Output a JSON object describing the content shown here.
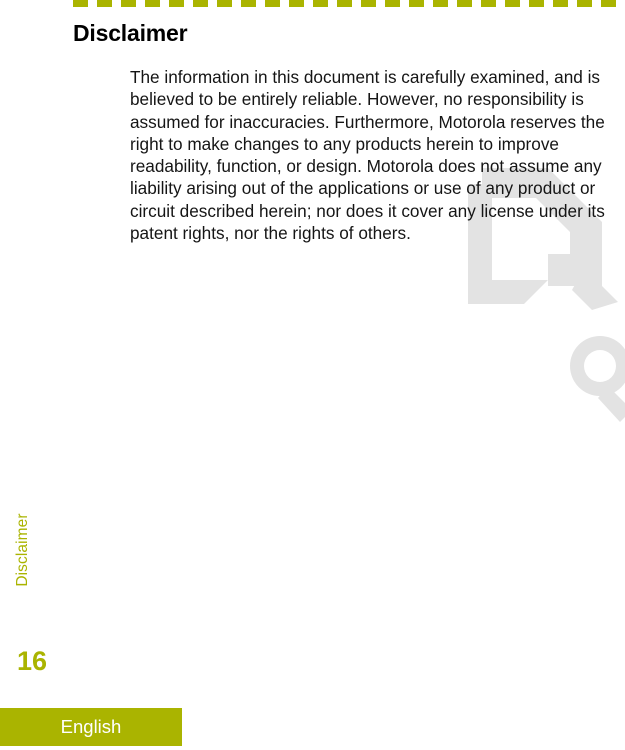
{
  "theme": {
    "accent_color": "#aab400",
    "text_color": "#151515",
    "heading_color": "#000000",
    "footer_text_color": "#ffffff",
    "watermark_color": "#e3e3e3",
    "page_background": "#ffffff"
  },
  "header": {
    "title": "Disclaimer",
    "rule_style": "dashed"
  },
  "content": {
    "paragraph": "The information in this document is carefully examined, and is believed to be entirely reliable. However, no responsibility is assumed for inaccuracies. Furthermore, Motorola reserves the right to make changes to any products herein to improve readability, function, or design. Motorola does not assume any liability arising out of the applications or use of any product or circuit described herein; nor does it cover any license under its patent rights, nor the rights of others.",
    "lines": [
      "The information in this document is carefully",
      "examined, and is believed to be entirely reliable.",
      "However, no responsibility is assumed for",
      "inaccuracies. Furthermore, Motorola reserves the",
      "right to make changes to any products herein to",
      "improve readability, function, or design. Motorola",
      "does not assume any liability arising out of the",
      "applications or use of any product or circuit described",
      "herein; nor does it cover any license under its patent",
      "rights, nor the rights of others."
    ]
  },
  "sidebar": {
    "chapter_label": "Disclaimer"
  },
  "footer": {
    "page_number": "16",
    "language": "English"
  },
  "watermarks": [
    {
      "name": "logo-d-mark",
      "shape": "stylized-angular-d"
    },
    {
      "name": "logo-ring-mark",
      "shape": "ring-with-tail"
    }
  ]
}
